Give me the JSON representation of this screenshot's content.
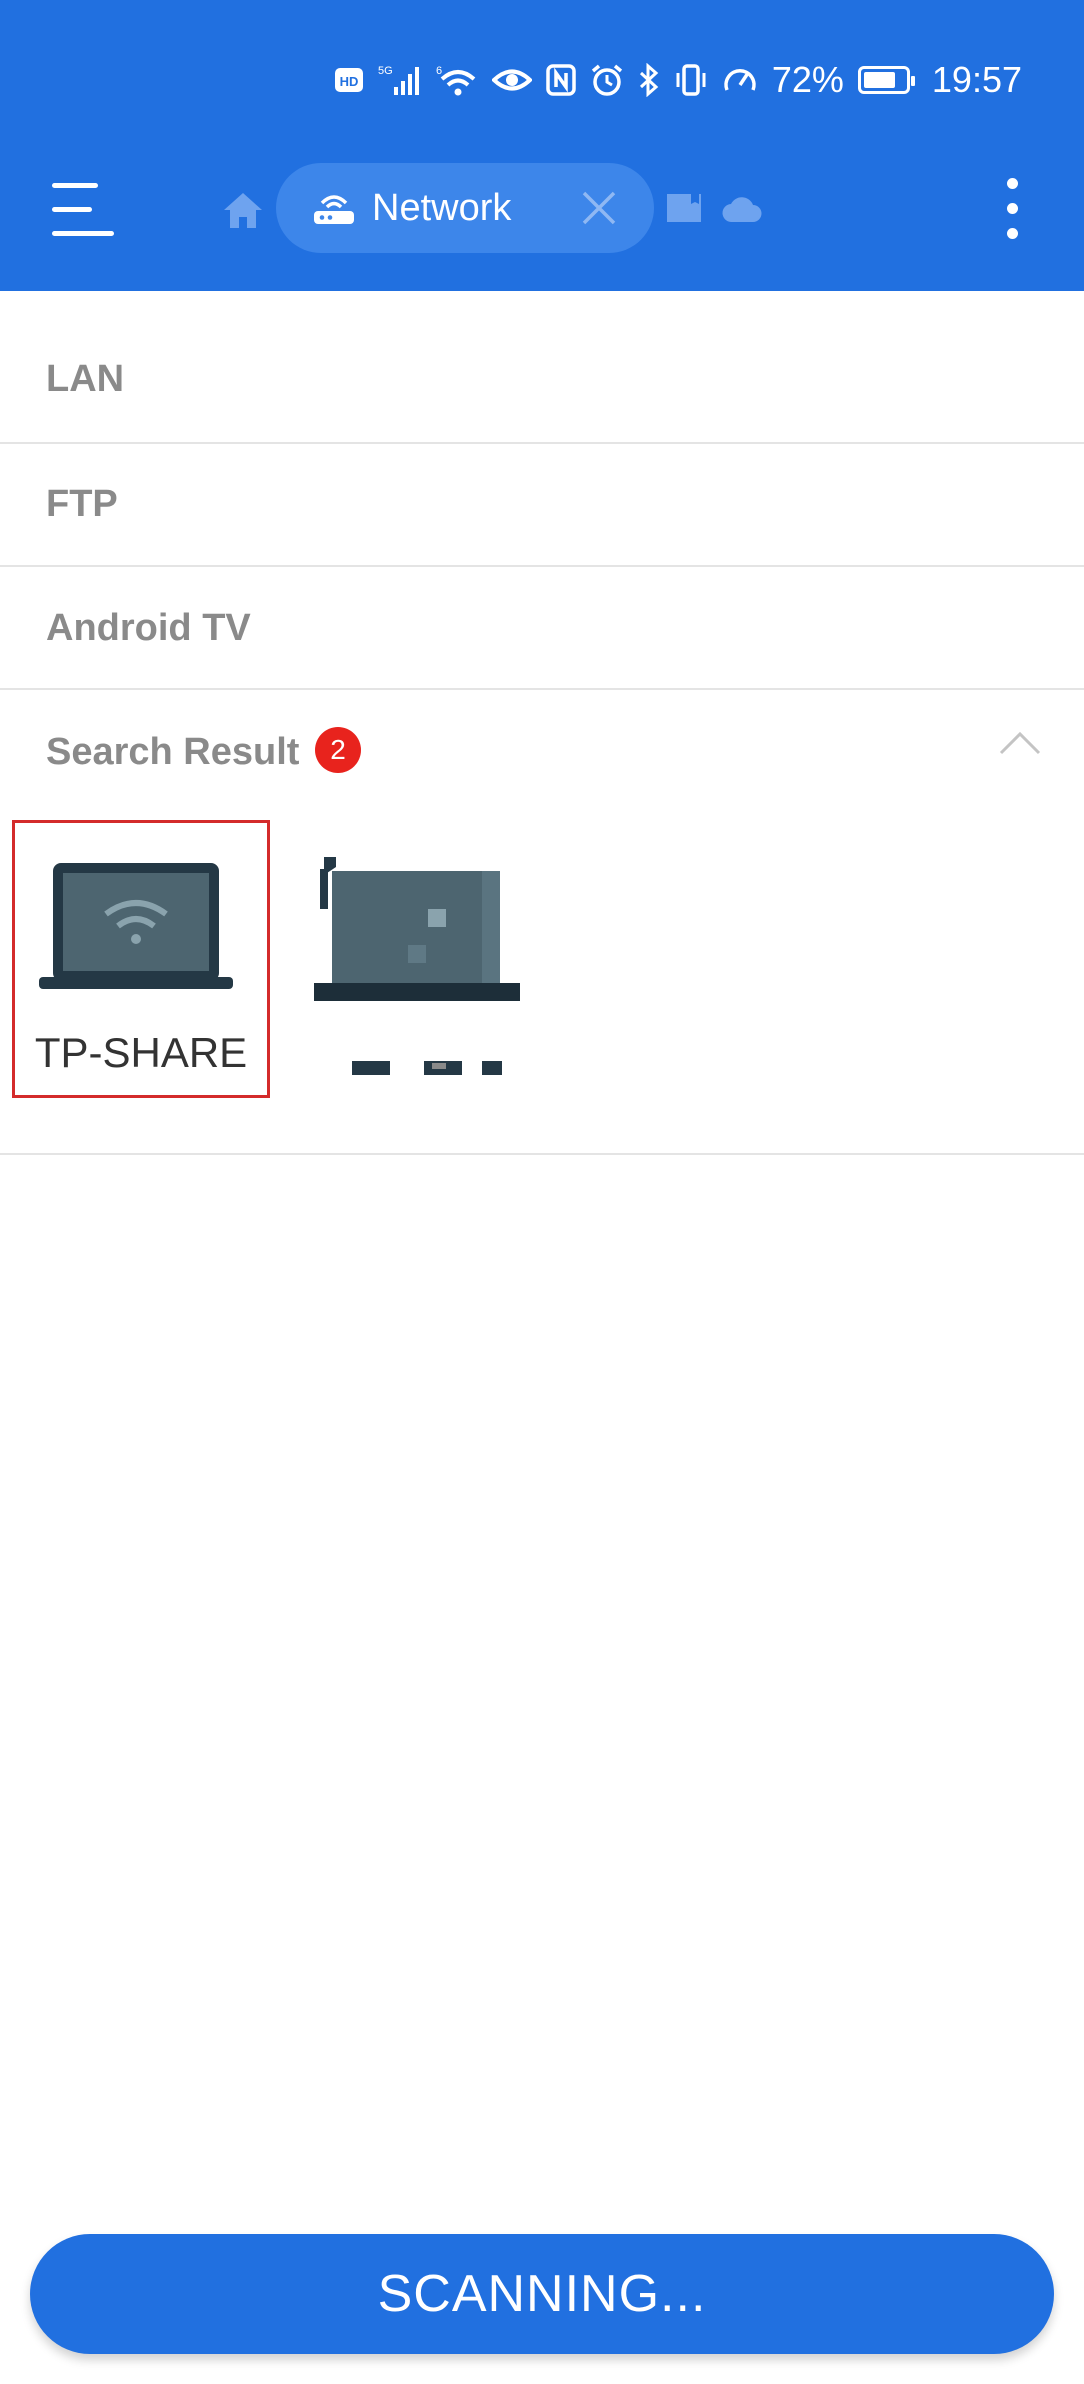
{
  "status_bar": {
    "battery": "72%",
    "time": "19:57",
    "icons": [
      "hd-icon",
      "5g-signal-icon",
      "wifi-6-icon",
      "eye-icon",
      "nfc-icon",
      "alarm-icon",
      "bluetooth-icon",
      "vibrate-icon",
      "speed-icon",
      "battery-icon"
    ]
  },
  "toolbar": {
    "active_tab": "Network",
    "icons": [
      "menu-icon",
      "home-icon",
      "router-icon",
      "close-icon",
      "sd-card-icon",
      "cloud-icon",
      "more-icon"
    ]
  },
  "sections": {
    "lan": "LAN",
    "ftp": "FTP",
    "android_tv": "Android TV",
    "search_result": "Search Result",
    "search_result_count": "2"
  },
  "devices": [
    {
      "name": "TP-SHARE",
      "icon": "laptop-wifi-icon",
      "selected": true
    },
    {
      "name": "",
      "icon": "laptop-icon",
      "selected": false
    }
  ],
  "scan_button": {
    "label": "SCANNING..."
  },
  "colors": {
    "primary": "#2170e0",
    "badge": "#e8231d",
    "selection": "#d42b2b"
  }
}
